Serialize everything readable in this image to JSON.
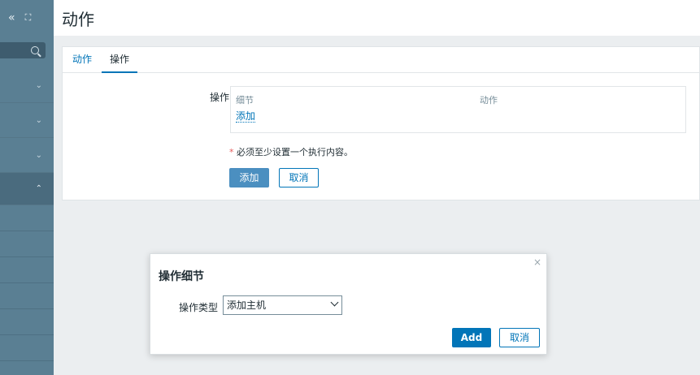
{
  "sidebar": {
    "collapse_icon": "double-chevron-left-icon",
    "toggle_icon": "window-icon",
    "collapse_glyph": "«",
    "toggle_glyph": "⛶",
    "search_icon": "search-icon",
    "menu_chevrons": [
      "⌄",
      "⌄",
      "⌄",
      "⌃"
    ]
  },
  "header": {
    "title": "动作"
  },
  "tabs": [
    {
      "label": "动作",
      "active": false
    },
    {
      "label": "操作",
      "active": true
    }
  ],
  "operations": {
    "label": "操作",
    "col_detail": "细节",
    "col_action": "动作",
    "add_link": "添加",
    "required_star": "*",
    "required_note": " 必须至少设置一个执行内容。",
    "add_button": "添加",
    "cancel_button": "取消"
  },
  "dialog": {
    "close_glyph": "×",
    "title": "操作细节",
    "type_label": "操作类型",
    "type_value": "添加主机",
    "add_button": "Add",
    "cancel_button": "取消"
  },
  "colors": {
    "sidebar": "#5a7f93",
    "link": "#0275b8",
    "primary_button": "#4b8fc0"
  }
}
